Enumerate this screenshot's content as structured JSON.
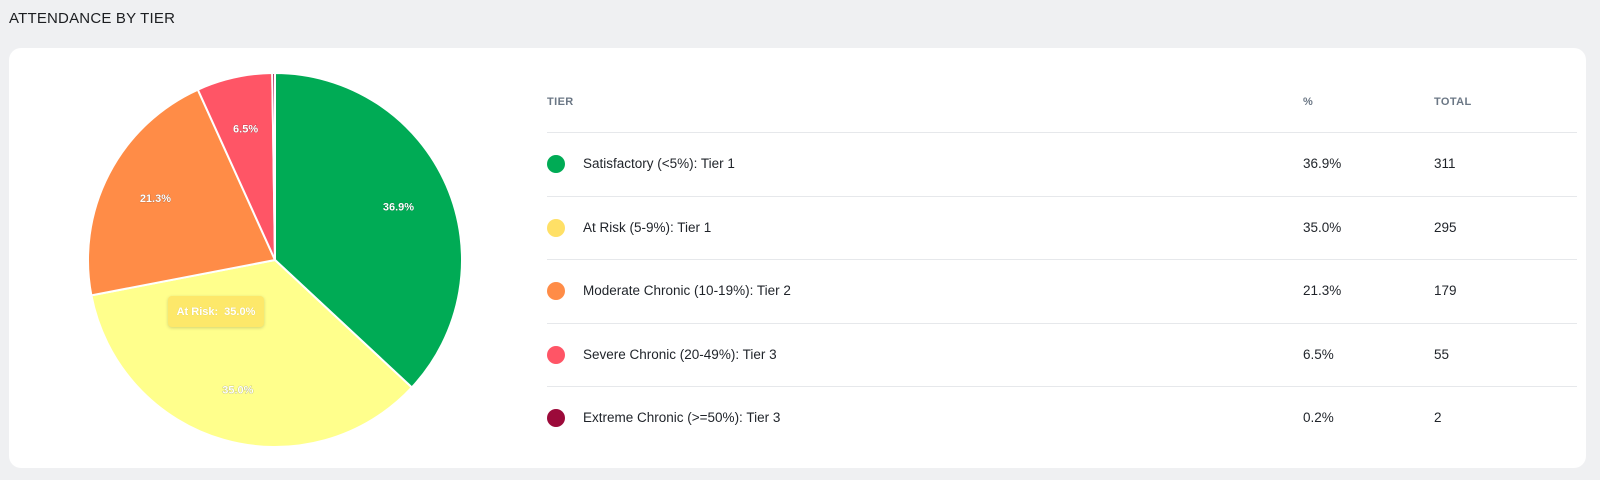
{
  "page": {
    "title": "ATTENDANCE BY TIER"
  },
  "tooltip": {
    "label": "At Risk:",
    "value": "35.0%"
  },
  "table": {
    "headers": {
      "tier": "TIER",
      "pct": "%",
      "total": "TOTAL"
    },
    "rows": [
      {
        "tier": "Satisfactory (<5%): Tier 1",
        "pct": "36.9%",
        "total": "311",
        "color": "#00ab55"
      },
      {
        "tier": "At Risk (5-9%): Tier 1",
        "pct": "35.0%",
        "total": "295",
        "color": "#ffe066"
      },
      {
        "tier": "Moderate Chronic (10-19%): Tier 2",
        "pct": "21.3%",
        "total": "179",
        "color": "#ff8c47"
      },
      {
        "tier": "Severe Chronic (20-49%): Tier 3",
        "pct": "6.5%",
        "total": "55",
        "color": "#ff5566"
      },
      {
        "tier": "Extreme Chronic (>=50%): Tier 3",
        "pct": "0.2%",
        "total": "2",
        "color": "#9c0a3a"
      }
    ]
  },
  "chart_data": {
    "type": "pie",
    "categories": [
      "Satisfactory (<5%): Tier 1",
      "At Risk (5-9%): Tier 1",
      "Moderate Chronic (10-19%): Tier 2",
      "Severe Chronic (20-49%): Tier 3",
      "Extreme Chronic (>=50%): Tier 3"
    ],
    "values": [
      311,
      295,
      179,
      55,
      2
    ],
    "data_labels": [
      "36.9%",
      "35.0%",
      "21.3%",
      "6.5%",
      ""
    ],
    "colors": [
      "#00ab55",
      "#ffff8c",
      "#ff8c47",
      "#ff5566",
      "#9c0a3a"
    ],
    "start_angle": "12 o'clock",
    "direction": "clockwise",
    "legend": "table-right"
  }
}
